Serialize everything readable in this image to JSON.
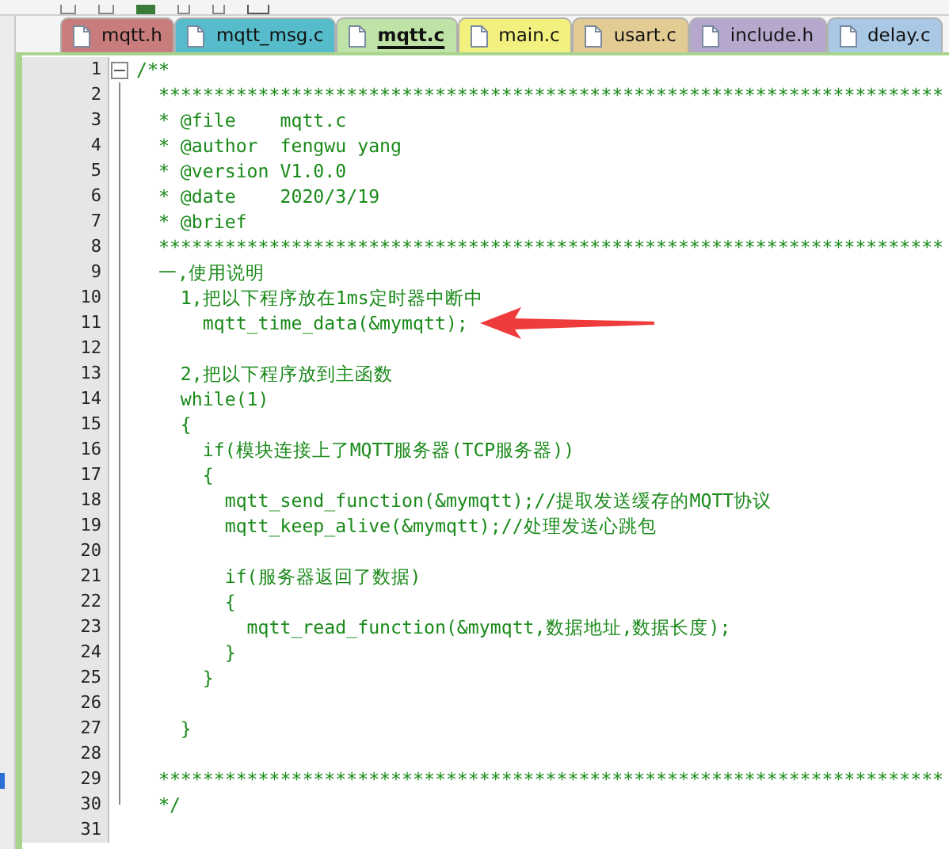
{
  "tabs": [
    {
      "label": "mqtt.h",
      "color": "#c97c7c",
      "selected": false
    },
    {
      "label": "mqtt_msg.c",
      "color": "#56bccb",
      "selected": false
    },
    {
      "label": "mqtt.c",
      "color": "#bfe3a6",
      "selected": true
    },
    {
      "label": "main.c",
      "color": "#f2f07e",
      "selected": false
    },
    {
      "label": "usart.c",
      "color": "#e3cc93",
      "selected": false
    },
    {
      "label": "include.h",
      "color": "#b6a8cc",
      "selected": false
    },
    {
      "label": "delay.c",
      "color": "#a9c8e4",
      "selected": false
    }
  ],
  "editor": {
    "fold": {
      "expanded": true
    },
    "lines": [
      {
        "number": "1",
        "text": "/**"
      },
      {
        "number": "2",
        "text": "  ***********************************************************************"
      },
      {
        "number": "3",
        "text": "  * @file    mqtt.c"
      },
      {
        "number": "4",
        "text": "  * @author  fengwu yang"
      },
      {
        "number": "5",
        "text": "  * @version V1.0.0"
      },
      {
        "number": "6",
        "text": "  * @date    2020/3/19"
      },
      {
        "number": "7",
        "text": "  * @brief"
      },
      {
        "number": "8",
        "text": "  ***********************************************************************"
      },
      {
        "number": "9",
        "text": "  一,使用说明"
      },
      {
        "number": "10",
        "text": "    1,把以下程序放在1ms定时器中断中"
      },
      {
        "number": "11",
        "text": "      mqtt_time_data(&mymqtt);"
      },
      {
        "number": "12"
      },
      {
        "number": "13",
        "text": "    2,把以下程序放到主函数"
      },
      {
        "number": "14",
        "text": "    while(1)"
      },
      {
        "number": "15",
        "text": "    {"
      },
      {
        "number": "16",
        "text": "      if(模块连接上了MQTT服务器(TCP服务器))"
      },
      {
        "number": "17",
        "text": "      {"
      },
      {
        "number": "18",
        "text": "        mqtt_send_function(&mymqtt);//提取发送缓存的MQTT协议"
      },
      {
        "number": "19",
        "text": "        mqtt_keep_alive(&mymqtt);//处理发送心跳包"
      },
      {
        "number": "20"
      },
      {
        "number": "21",
        "text": "        if(服务器返回了数据)"
      },
      {
        "number": "22",
        "text": "        {"
      },
      {
        "number": "23",
        "text": "          mqtt_read_function(&mymqtt,数据地址,数据长度);"
      },
      {
        "number": "24",
        "text": "        }"
      },
      {
        "number": "25",
        "text": "      }"
      },
      {
        "number": "26"
      },
      {
        "number": "27",
        "text": "    }"
      },
      {
        "number": "28"
      },
      {
        "number": "29",
        "text": "  ***********************************************************************"
      },
      {
        "number": "30",
        "text": "  */"
      },
      {
        "number": "31"
      }
    ]
  }
}
